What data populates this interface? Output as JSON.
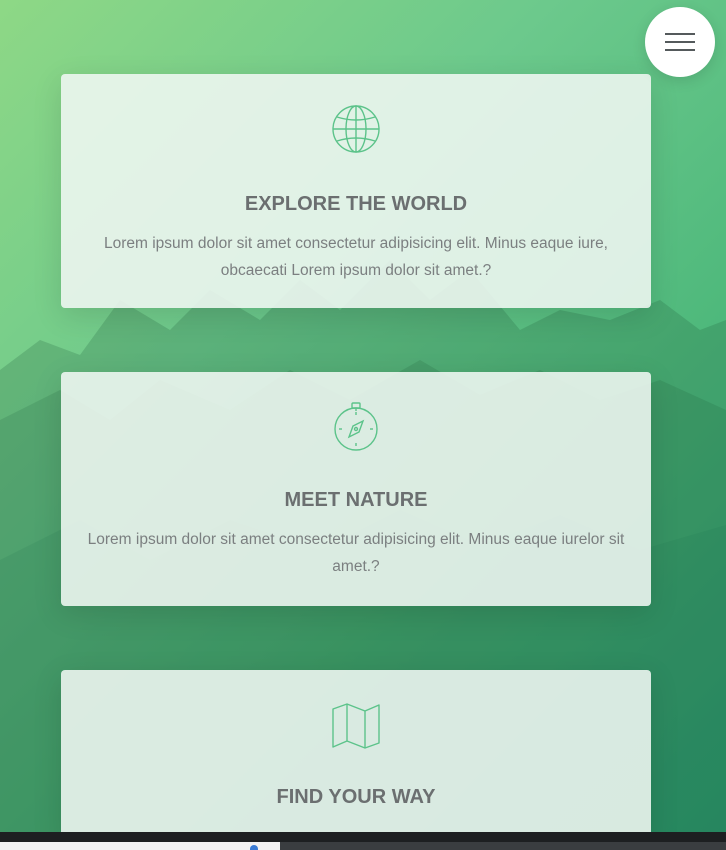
{
  "menu": {
    "icon": "hamburger-menu-icon"
  },
  "features": [
    {
      "icon": "globe-icon",
      "title": "EXPLORE THE WORLD",
      "text": "Lorem ipsum dolor sit amet consectetur adipisicing elit. Minus eaque iure, obcaecati Lorem ipsum dolor sit amet.?"
    },
    {
      "icon": "compass-icon",
      "title": "MEET NATURE",
      "text": "Lorem ipsum dolor sit amet consectetur adipisicing elit. Minus eaque iurelor sit amet.?"
    },
    {
      "icon": "map-icon",
      "title": "FIND YOUR WAY",
      "text": ""
    }
  ],
  "colors": {
    "accent": "#5cc38a",
    "background_start": "#8ed886",
    "background_end": "#2fa57a",
    "heading": "#6b6f70",
    "body_text": "#7b7f80"
  }
}
